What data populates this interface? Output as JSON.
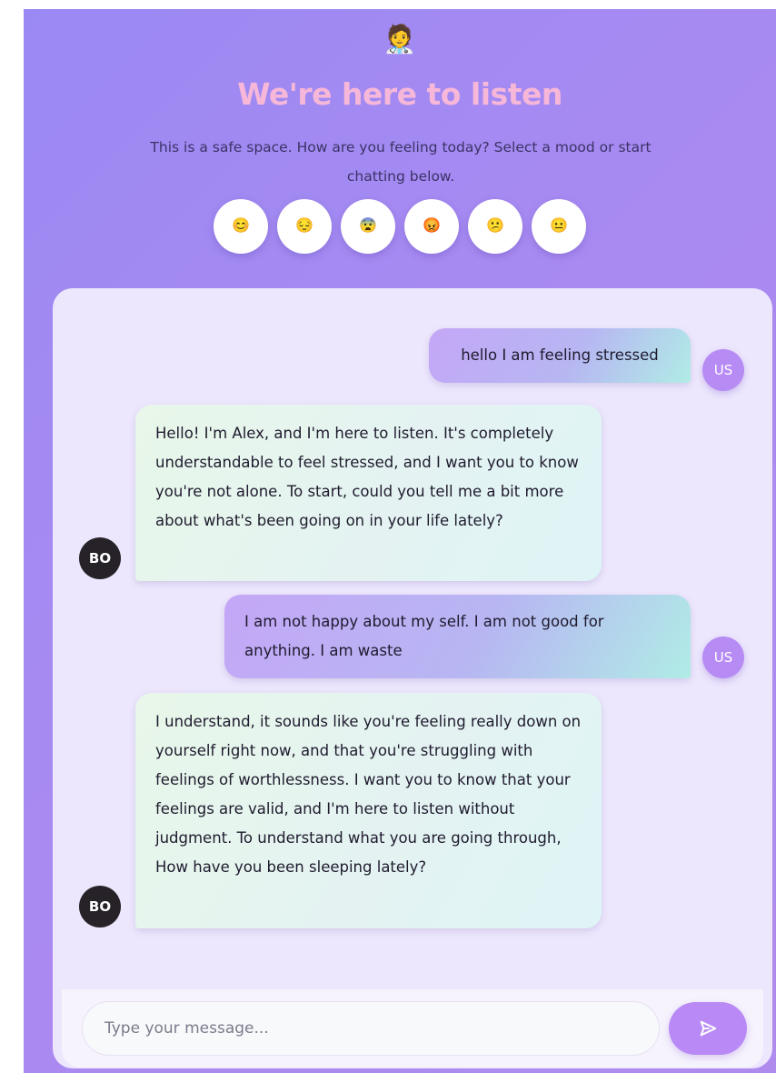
{
  "header": {
    "emoji": "🧑‍⚕️",
    "title": "We're here to listen",
    "subtitle": "This is a safe space. How are you feeling today? Select a mood or start chatting below."
  },
  "moods": [
    {
      "emoji": "😊",
      "icon": "smiling-face-icon"
    },
    {
      "emoji": "😔",
      "icon": "pensive-face-icon"
    },
    {
      "emoji": "😨",
      "icon": "fearful-face-icon"
    },
    {
      "emoji": "😡",
      "icon": "angry-face-icon"
    },
    {
      "emoji": "😕",
      "icon": "confused-face-icon"
    },
    {
      "emoji": "😐",
      "icon": "neutral-face-icon"
    }
  ],
  "messages": [
    {
      "role": "user",
      "avatar": "US",
      "text": "hello I am feeling stressed"
    },
    {
      "role": "bot",
      "avatar": "BO",
      "text": "Hello! I'm Alex, and I'm here to listen. It's completely understandable to feel stressed, and I want you to know you're not alone. To start, could you tell me a bit more about what's been going on in your life lately?"
    },
    {
      "role": "user",
      "avatar": "US",
      "text": "I am not happy about my self. I am not good for anything. I am waste"
    },
    {
      "role": "bot",
      "avatar": "BO",
      "text": "I understand, it sounds like you're feeling really down on yourself right now, and that you're struggling with feelings of worthlessness. I want you to know that your feelings are valid, and I'm here to listen without judgment. To understand what you are going through, How have you been sleeping lately?"
    }
  ],
  "input": {
    "placeholder": "Type your message...",
    "value": ""
  },
  "send": {
    "icon": "send-icon"
  },
  "colors": {
    "background_gradient_start": "#9b89f3",
    "background_gradient_end": "#b08bee",
    "title": "#f6b7d8",
    "accent": "#b98af5",
    "bot_avatar": "#262228"
  }
}
